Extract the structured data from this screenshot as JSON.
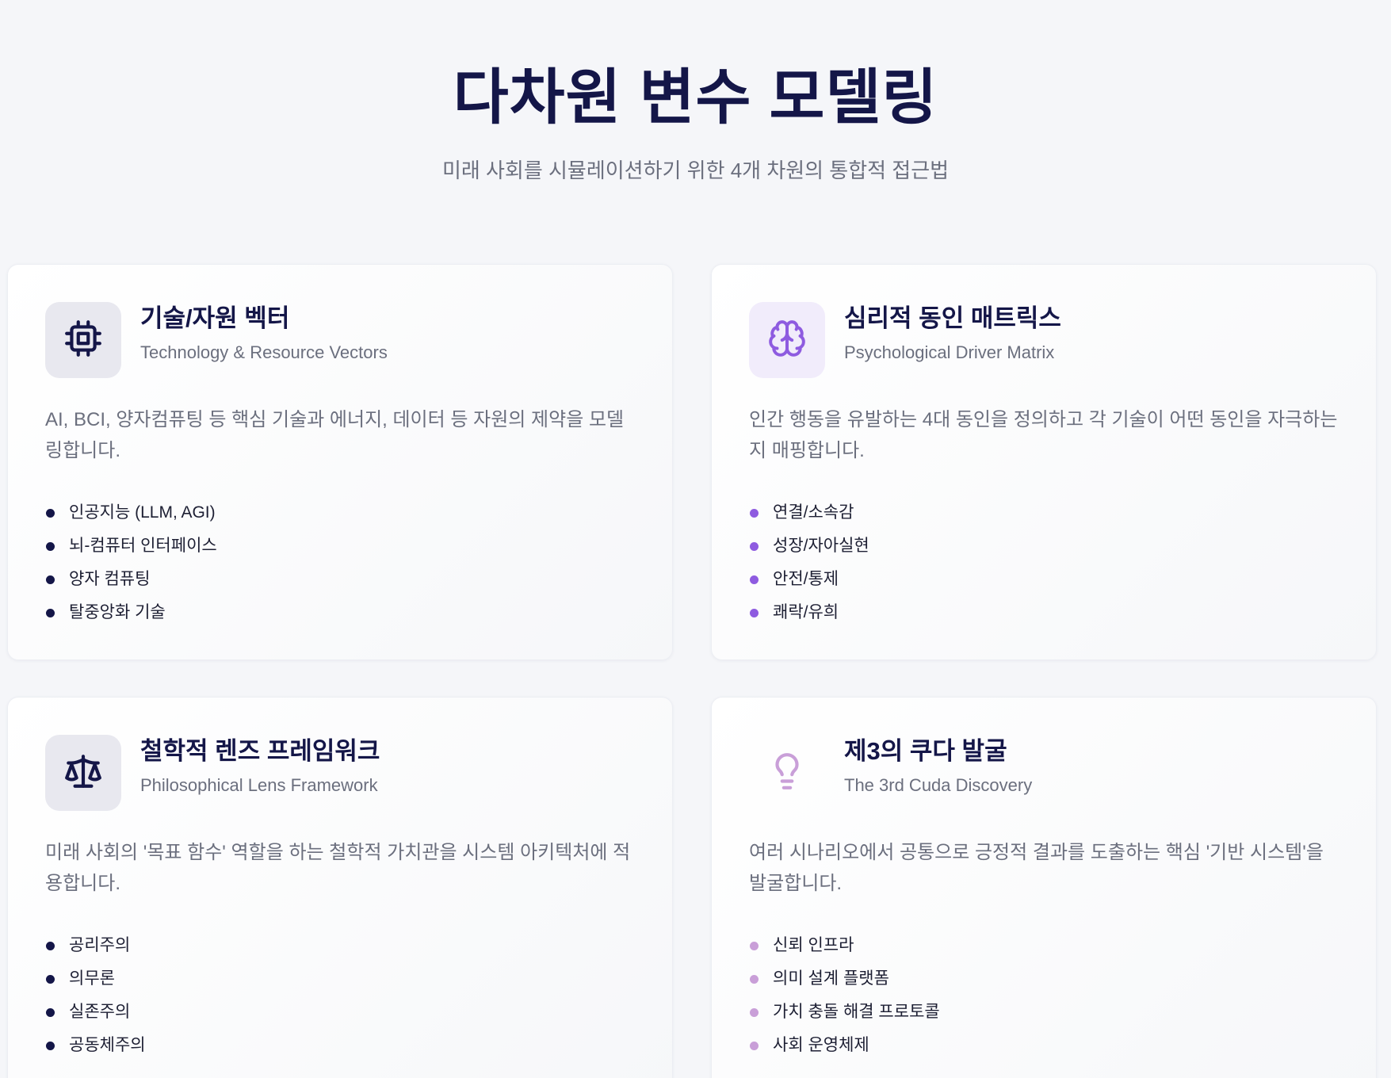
{
  "header": {
    "title": "다차원 변수 모델링",
    "subtitle": "미래 사회를 시뮬레이션하기 위한 4개 차원의 통합적 접근법"
  },
  "cards": [
    {
      "title": "기술/자원 벡터",
      "subtitle": "Technology & Resource Vectors",
      "description": "AI, BCI, 양자컴퓨팅 등 핵심 기술과 에너지, 데이터 등 자원의 제약을 모델링합니다.",
      "icon": "cpu-icon",
      "accent": "#141648",
      "icon_bg": "#e8e8ef",
      "items": [
        "인공지능 (LLM, AGI)",
        "뇌-컴퓨터 인터페이스",
        "양자 컴퓨팅",
        "탈중앙화 기술"
      ]
    },
    {
      "title": "심리적 동인 매트릭스",
      "subtitle": "Psychological Driver Matrix",
      "description": "인간 행동을 유발하는 4대 동인을 정의하고 각 기술이 어떤 동인을 자극하는지 매핑합니다.",
      "icon": "brain-icon",
      "accent": "#8e5be0",
      "icon_bg": "#f1ecfb",
      "items": [
        "연결/소속감",
        "성장/자아실현",
        "안전/통제",
        "쾌락/유희"
      ]
    },
    {
      "title": "철학적 렌즈 프레임워크",
      "subtitle": "Philosophical Lens Framework",
      "description": "미래 사회의 '목표 함수' 역할을 하는 철학적 가치관을 시스템 아키텍처에 적용합니다.",
      "icon": "scale-icon",
      "accent": "#141648",
      "icon_bg": "#e8e8ef",
      "items": [
        "공리주의",
        "의무론",
        "실존주의",
        "공동체주의"
      ]
    },
    {
      "title": "제3의 쿠다 발굴",
      "subtitle": "The 3rd Cuda Discovery",
      "description": "여러 시나리오에서 공통으로 긍정적 결과를 도출하는 핵심 '기반 시스템'을 발굴합니다.",
      "icon": "lightbulb-icon",
      "accent": "#c99fd8",
      "icon_bg": "transparent",
      "items": [
        "신뢰 인프라",
        "의미 설계 플랫폼",
        "가치 충돌 해결 프로토콜",
        "사회 운영체제"
      ]
    }
  ]
}
